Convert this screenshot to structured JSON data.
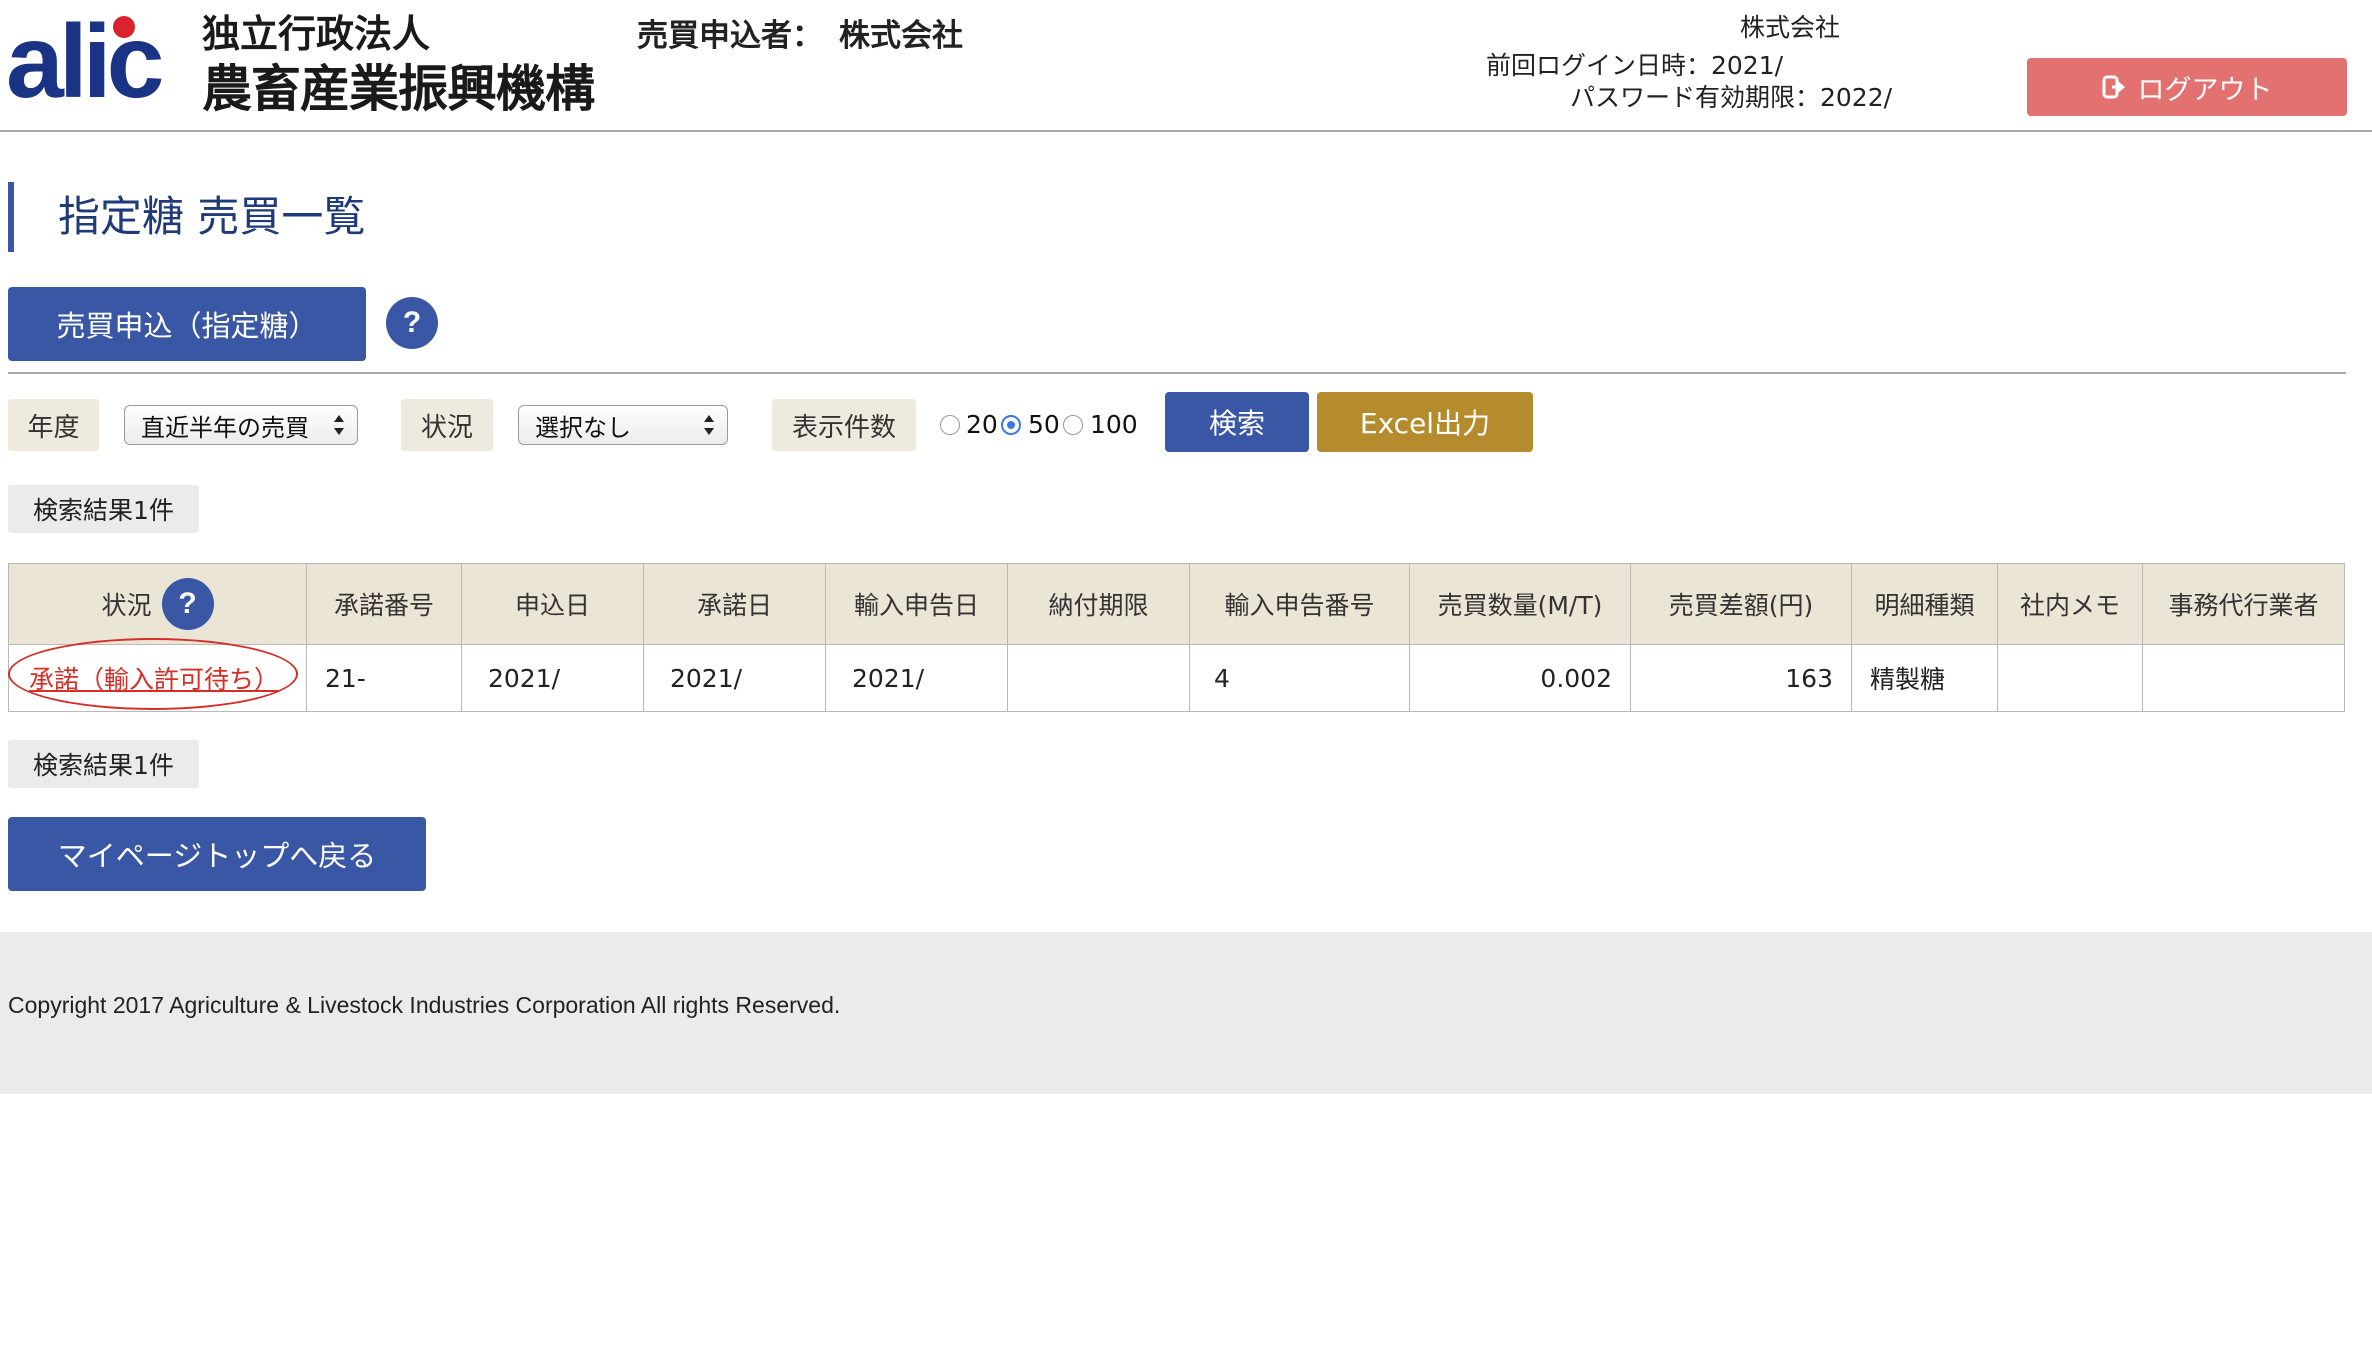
{
  "header": {
    "logo_mark": "alic",
    "org_line1": "独立行政法人",
    "org_line2": "農畜産業振興機構",
    "applicant_label": "売買申込者：",
    "applicant_value": "株式会社",
    "account_company": "株式会社",
    "last_login": "前回ログイン日時：2021/",
    "password_expiry": "パスワード有効期限：2022/",
    "logout_label": "ログアウト"
  },
  "page": {
    "title": "指定糖 売買一覧",
    "apply_button": "売買申込（指定糖）",
    "help_glyph": "?"
  },
  "filters": {
    "year_label": "年度",
    "year_value": "直近半年の売買",
    "status_label": "状況",
    "status_value": "選択なし",
    "count_label": "表示件数",
    "count_options": [
      {
        "label": "20",
        "selected": false
      },
      {
        "label": "50",
        "selected": true
      },
      {
        "label": "100",
        "selected": false
      }
    ],
    "search_button": "検索",
    "excel_button": "Excel出力"
  },
  "results": {
    "count_top": "検索結果1件",
    "count_bottom": "検索結果1件"
  },
  "table": {
    "columns": [
      "状況",
      "承諾番号",
      "申込日",
      "承諾日",
      "輸入申告日",
      "納付期限",
      "輸入申告番号",
      "売買数量(M/T)",
      "売買差額(円)",
      "明細種類",
      "社内メモ",
      "事務代行業者"
    ],
    "rows": [
      {
        "status": "承諾（輸入許可待ち）",
        "acceptance_no": "21-",
        "apply_date": "2021/",
        "accept_date": "2021/",
        "import_decl_date": "2021/",
        "payment_due": "",
        "import_decl_no": "4",
        "quantity": "0.002",
        "price_diff": "163",
        "detail_type": "精製糖",
        "memo": "",
        "agent": ""
      }
    ]
  },
  "nav": {
    "back_button": "マイページトップへ戻る"
  },
  "footer": {
    "copyright": "Copyright 2017 Agriculture & Livestock Industries Corporation All rights Reserved."
  },
  "colors": {
    "brand_blue": "#3a57a5",
    "excel_gold": "#b48c2d",
    "logout_red": "#e2716f",
    "status_red": "#d62d25",
    "header_beige": "#ebe5d6"
  }
}
